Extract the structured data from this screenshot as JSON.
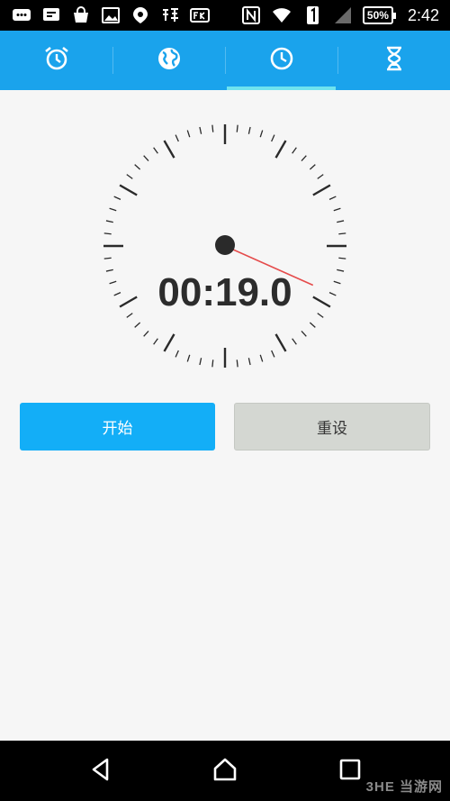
{
  "status_bar": {
    "left_icons": [
      "chat-icon",
      "message-icon",
      "bag-icon",
      "image-icon",
      "baidu-icon",
      "taobao-icon",
      "fk-icon"
    ],
    "right_icons": [
      "nfc-icon",
      "wifi-icon",
      "sim-icon",
      "signal-icon"
    ],
    "battery": "50%",
    "time": "2:42"
  },
  "tabs": [
    {
      "icon": "alarm-clock-icon",
      "active": false
    },
    {
      "icon": "globe-icon",
      "active": false
    },
    {
      "icon": "stopwatch-icon",
      "active": true
    },
    {
      "icon": "hourglass-icon",
      "active": false
    }
  ],
  "stopwatch": {
    "elapsed": "00:19.0",
    "seconds": 19.0
  },
  "buttons": {
    "start": "开始",
    "reset": "重设"
  },
  "nav": [
    "back-icon",
    "home-icon",
    "recents-icon"
  ],
  "watermark": "3HE 当游网",
  "colors": {
    "accent": "#1aa3ec",
    "tab_indicator": "#6fe3ef",
    "start_button": "#13aef7",
    "reset_button": "#d4d7d2",
    "hand": "#e54b4b"
  }
}
